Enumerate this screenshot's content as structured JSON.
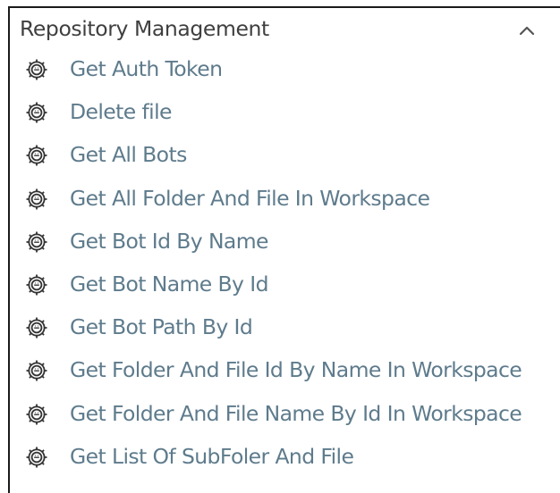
{
  "panel": {
    "title": "Repository Management",
    "collapse_icon": "chevron-up-icon"
  },
  "items": [
    {
      "label": "Get Auth Token",
      "icon": "bot-gear-icon"
    },
    {
      "label": "Delete file",
      "icon": "bot-gear-icon"
    },
    {
      "label": "Get All Bots",
      "icon": "bot-gear-icon"
    },
    {
      "label": "Get All Folder And File In Workspace",
      "icon": "bot-gear-icon"
    },
    {
      "label": "Get Bot Id By Name",
      "icon": "bot-gear-icon"
    },
    {
      "label": "Get Bot Name By Id",
      "icon": "bot-gear-icon"
    },
    {
      "label": "Get Bot Path By Id",
      "icon": "bot-gear-icon"
    },
    {
      "label": "Get Folder And File Id By Name In Workspace",
      "icon": "bot-gear-icon"
    },
    {
      "label": "Get Folder And File Name By Id In Workspace",
      "icon": "bot-gear-icon"
    },
    {
      "label": "Get List Of SubFoler And File",
      "icon": "bot-gear-icon"
    }
  ],
  "colors": {
    "title": "#3f3f3f",
    "item_text": "#5e7b8c",
    "border": "#1a1a1a",
    "icon": "#333333"
  }
}
